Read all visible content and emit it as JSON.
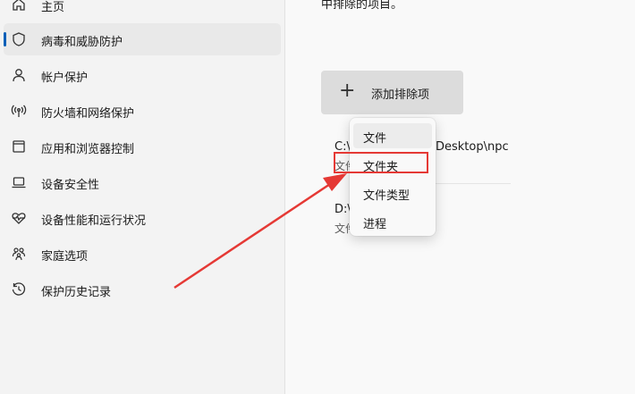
{
  "sidebar": {
    "items": [
      {
        "label": "主页",
        "icon": "home-icon"
      },
      {
        "label": "病毒和威胁防护",
        "icon": "shield-icon",
        "selected": true
      },
      {
        "label": "帐户保护",
        "icon": "person-icon"
      },
      {
        "label": "防火墙和网络保护",
        "icon": "wifi-broadcast-icon"
      },
      {
        "label": "应用和浏览器控制",
        "icon": "app-window-icon"
      },
      {
        "label": "设备安全性",
        "icon": "laptop-icon"
      },
      {
        "label": "设备性能和运行状况",
        "icon": "heart-pulse-icon"
      },
      {
        "label": "家庭选项",
        "icon": "family-icon"
      },
      {
        "label": "保护历史记录",
        "icon": "history-icon"
      }
    ],
    "accent_color": "#005fb8"
  },
  "main": {
    "clipped_text": "中排除的项目。",
    "add_button": {
      "icon": "plus-icon",
      "label": "添加排除项"
    },
    "entries": [
      {
        "path_prefix": "C:\\",
        "path_suffix": "Desktop\\npc",
        "type_prefix": "文件"
      },
      {
        "path_prefix": "D:\\",
        "type_prefix": "文件"
      }
    ]
  },
  "menu": {
    "items": [
      "文件",
      "文件夹",
      "文件类型",
      "进程"
    ],
    "hovered_index": 0
  },
  "annotation": {
    "highlight_color": "#e53935"
  }
}
